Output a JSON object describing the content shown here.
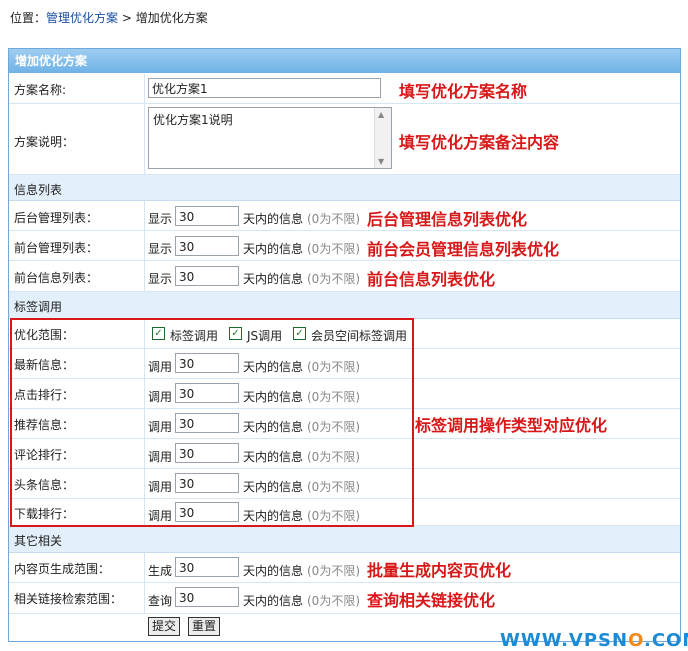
{
  "breadcrumb": {
    "prefix": "位置：",
    "link": "管理优化方案",
    "sep": " > ",
    "current": "增加优化方案"
  },
  "panel_title": "增加优化方案",
  "plan_name": {
    "label": "方案名称:",
    "value": "优化方案1",
    "note": "填写优化方案名称"
  },
  "plan_desc": {
    "label": "方案说明：",
    "value": "优化方案1说明",
    "note": "填写优化方案备注内容"
  },
  "sections": {
    "info_list": "信息列表",
    "tag_call": "标签调用",
    "other": "其它相关"
  },
  "info_rows": [
    {
      "label": "后台管理列表：",
      "verb": "显示",
      "value": "30",
      "unit": "天内的信息",
      "hint": "(0为不限)",
      "note": "后台管理信息列表优化"
    },
    {
      "label": "前台管理列表：",
      "verb": "显示",
      "value": "30",
      "unit": "天内的信息",
      "hint": "(0为不限)",
      "note": "前台会员管理信息列表优化"
    },
    {
      "label": "前台信息列表：",
      "verb": "显示",
      "value": "30",
      "unit": "天内的信息",
      "hint": "(0为不限)",
      "note": "前台信息列表优化"
    }
  ],
  "scope": {
    "label": "优化范围：",
    "options": [
      "标签调用",
      "JS调用",
      "会员空间标签调用"
    ],
    "checked": [
      true,
      true,
      true
    ]
  },
  "tag_rows": [
    {
      "label": "最新信息：",
      "verb": "调用",
      "value": "30",
      "unit": "天内的信息",
      "hint": "(0为不限)"
    },
    {
      "label": "点击排行：",
      "verb": "调用",
      "value": "30",
      "unit": "天内的信息",
      "hint": "(0为不限)"
    },
    {
      "label": "推荐信息：",
      "verb": "调用",
      "value": "30",
      "unit": "天内的信息",
      "hint": "(0为不限)"
    },
    {
      "label": "评论排行：",
      "verb": "调用",
      "value": "30",
      "unit": "天内的信息",
      "hint": "(0为不限)"
    },
    {
      "label": "头条信息：",
      "verb": "调用",
      "value": "30",
      "unit": "天内的信息",
      "hint": "(0为不限)"
    },
    {
      "label": "下载排行：",
      "verb": "调用",
      "value": "30",
      "unit": "天内的信息",
      "hint": "(0为不限)"
    }
  ],
  "tag_note": "标签调用操作类型对应优化",
  "other_rows": [
    {
      "label": "内容页生成范围：",
      "verb": "生成",
      "value": "30",
      "unit": "天内的信息",
      "hint": "(0为不限)",
      "note": "批量生成内容页优化"
    },
    {
      "label": "相关链接检索范围：",
      "verb": "查询",
      "value": "30",
      "unit": "天内的信息",
      "hint": "(0为不限)",
      "note": "查询相关链接优化"
    }
  ],
  "buttons": {
    "submit": "提交",
    "reset": "重置"
  },
  "watermark": {
    "pre": "WWW.VPSN",
    "o": "O",
    "post": ".COM"
  },
  "colors": {
    "accent_red": "#d81818",
    "header_blue": "#6fb2e6",
    "section_bg": "#e3f0fb"
  }
}
